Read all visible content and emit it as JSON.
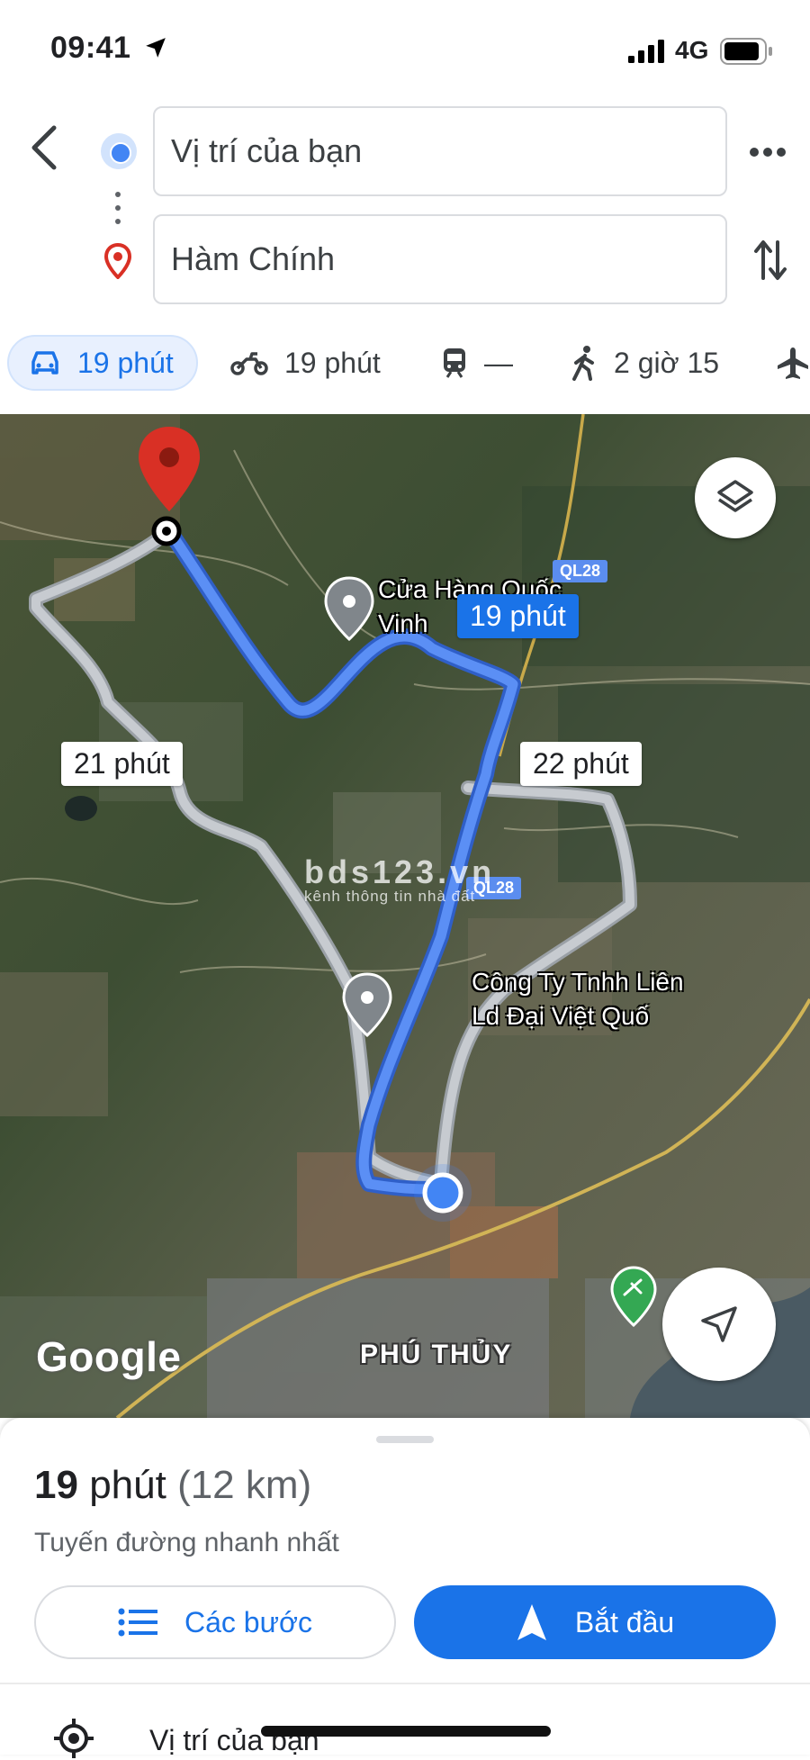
{
  "status_bar": {
    "time": "09:41",
    "network": "4G"
  },
  "directions": {
    "origin": "Vị trí của bạn",
    "destination": "Hàm Chính"
  },
  "modes": [
    {
      "icon": "car-icon",
      "label": "19 phút",
      "active": true
    },
    {
      "icon": "motorbike-icon",
      "label": "19 phút"
    },
    {
      "icon": "train-icon",
      "label": "—"
    },
    {
      "icon": "walk-icon",
      "label": "2 giờ 15"
    },
    {
      "icon": "plane-icon",
      "label": ""
    }
  ],
  "map": {
    "route_labels": {
      "main": "19 phút",
      "alt_left": "21 phút",
      "alt_right": "22 phút"
    },
    "road_shields": [
      "QL28",
      "QL28"
    ],
    "poi_store": [
      "Cửa Hàng Quốc",
      "Vinh"
    ],
    "poi_company": [
      "Công Ty Tnhh Liên",
      "Ld Đại Việt Quố"
    ],
    "district": "PHÚ THỦY",
    "watermark": {
      "main": "bds123.vn",
      "sub": "kênh thông tin nhà đất"
    },
    "logo": "Google",
    "colors": {
      "route_primary": "#4a80f0",
      "route_alt": "#b9c0c9",
      "destination_pin": "#d93025"
    }
  },
  "summary": {
    "duration_num": "19",
    "duration_unit": "phút",
    "distance": "(12 km)",
    "description": "Tuyến đường nhanh nhất"
  },
  "buttons": {
    "steps": "Các bước",
    "start": "Bắt đầu"
  },
  "steps_list": {
    "first": "Vị trí của bạn"
  },
  "colors": {
    "accent": "#1a73e8",
    "accent_light": "#e8f0fe"
  }
}
